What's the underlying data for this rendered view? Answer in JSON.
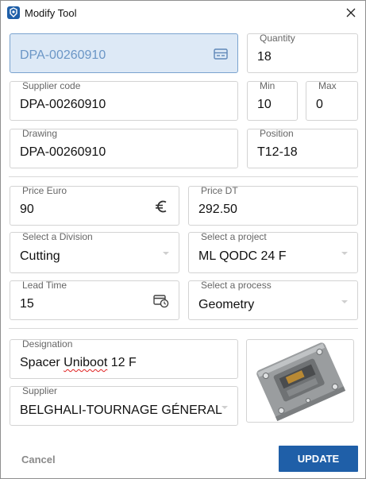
{
  "window": {
    "title": "Modify Tool"
  },
  "fields": {
    "code_value": "DPA-00260910",
    "quantity": {
      "label": "Quantity",
      "value": "18"
    },
    "supplier_code": {
      "label": "Supplier code",
      "value": "DPA-00260910"
    },
    "min": {
      "label": "Min",
      "value": "10"
    },
    "max": {
      "label": "Max",
      "value": "0"
    },
    "drawing": {
      "label": "Drawing",
      "value": "DPA-00260910"
    },
    "position": {
      "label": "Position",
      "value": "T12-18"
    },
    "price_euro": {
      "label": "Price Euro",
      "value": "90"
    },
    "price_dt": {
      "label": "Price DT",
      "value": "292.50"
    },
    "division": {
      "label": "Select a Division",
      "value": "Cutting"
    },
    "project": {
      "label": "Select a project",
      "value": "ML QODC 24 F"
    },
    "lead_time": {
      "label": "Lead Time",
      "value": "15"
    },
    "process": {
      "label": "Select a process",
      "value": "Geometry"
    },
    "designation": {
      "label": "Designation",
      "value_part1": "Spacer ",
      "value_misspelled": "Uniboot",
      "value_part2": " 12 F"
    },
    "supplier": {
      "label": "Supplier",
      "value": "BELGHALI-TOURNAGE GÉNERAL"
    }
  },
  "buttons": {
    "cancel": "Cancel",
    "update": "UPDATE"
  },
  "icons": {
    "app": "app-icon",
    "close": "close-icon",
    "barcode": "card-icon",
    "euro": "euro-icon",
    "lead_time": "calendar-clock-icon",
    "dropdown": "chevron-down-icon"
  },
  "colors": {
    "accent": "#1f5fa8",
    "active_field_bg": "#dde9f6",
    "cancel_text": "#8a8a8a"
  }
}
